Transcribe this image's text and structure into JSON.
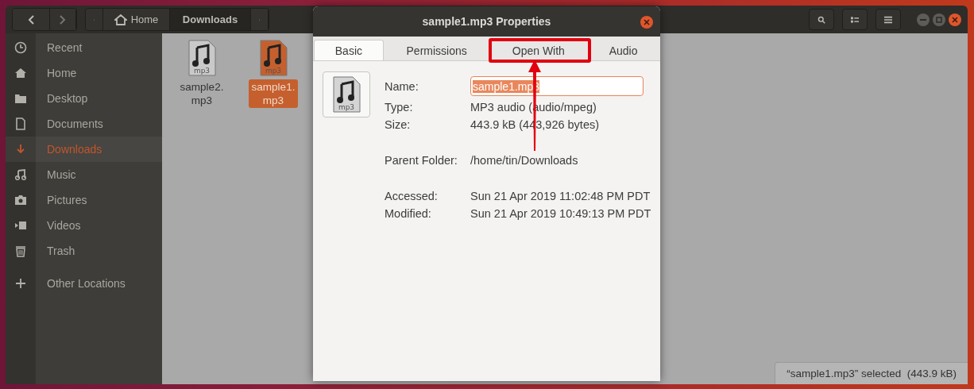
{
  "file_manager": {
    "path_bar": [
      {
        "kind": "home",
        "label": "Home",
        "selected": false
      },
      {
        "kind": "folder",
        "label": "Downloads",
        "selected": true
      }
    ],
    "sidebar": {
      "items": [
        {
          "kind": "recent",
          "label": "Recent",
          "selected": false
        },
        {
          "kind": "home",
          "label": "Home",
          "selected": false
        },
        {
          "kind": "desktop",
          "label": "Desktop",
          "selected": false
        },
        {
          "kind": "documents",
          "label": "Documents",
          "selected": false
        },
        {
          "kind": "downloads",
          "label": "Downloads",
          "selected": true
        },
        {
          "kind": "music",
          "label": "Music",
          "selected": false
        },
        {
          "kind": "pictures",
          "label": "Pictures",
          "selected": false
        },
        {
          "kind": "videos",
          "label": "Videos",
          "selected": false
        },
        {
          "kind": "trash",
          "label": "Trash",
          "selected": false
        },
        {
          "kind": "other",
          "label": "Other Locations",
          "selected": false
        }
      ]
    },
    "files": [
      {
        "name": "sample2.\nmp3",
        "icon_label": "mp3",
        "selected": false
      },
      {
        "name": "sample1.\nmp3",
        "icon_label": "mp3",
        "selected": true
      }
    ],
    "status_bar": "“sample1.mp3” selected  (443.9 kB)"
  },
  "dialog": {
    "title": "sample1.mp3 Properties",
    "tabs": [
      {
        "label": "Basic",
        "selected": true,
        "highlighted": false
      },
      {
        "label": "Permissions",
        "selected": false,
        "highlighted": false
      },
      {
        "label": "Open With",
        "selected": false,
        "highlighted": true
      },
      {
        "label": "Audio",
        "selected": false,
        "highlighted": false
      }
    ],
    "icon_label": "mp3",
    "name_field": {
      "label": "Name:",
      "value": "sample1.mp3",
      "text_selected": true
    },
    "property_sections": [
      [
        {
          "label": "Type:",
          "value": "MP3 audio (audio/mpeg)"
        },
        {
          "label": "Size:",
          "value": "443.9 kB (443,926 bytes)"
        }
      ],
      [
        {
          "label": "Parent Folder:",
          "value": "/home/tin/Downloads"
        }
      ],
      [
        {
          "label": "Accessed:",
          "value": "Sun 21 Apr 2019 11:02:48 PM PDT"
        },
        {
          "label": "Modified:",
          "value": "Sun 21 Apr 2019 10:49:13 PM PDT"
        }
      ]
    ]
  }
}
